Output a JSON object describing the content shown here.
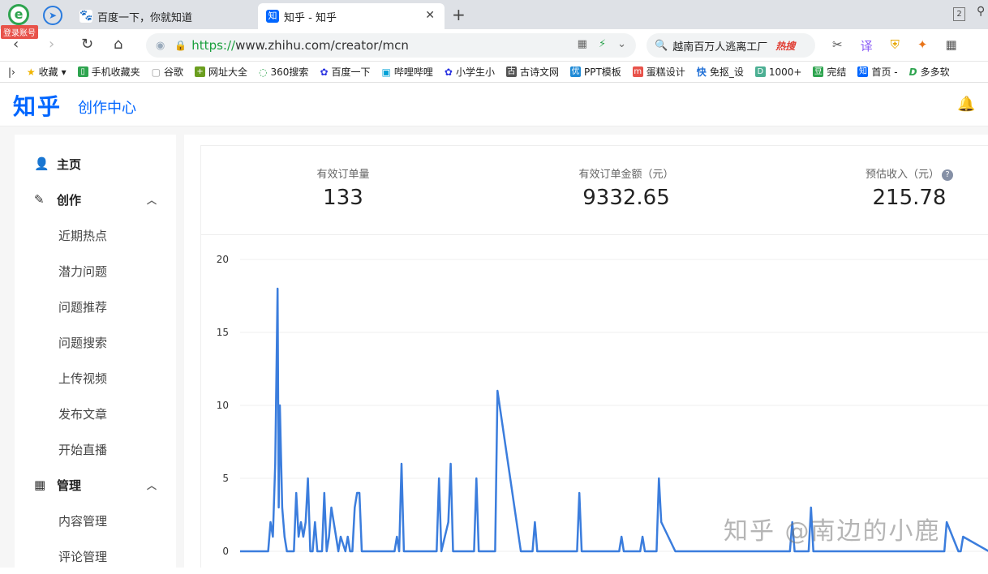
{
  "browser": {
    "login_badge": "登录账号",
    "tabs": [
      {
        "title": "百度一下，你就知道",
        "active": false
      },
      {
        "title": "知乎 - 知乎",
        "active": true
      }
    ],
    "window_count": "2",
    "url_scheme": "https://",
    "url_rest": "www.zhihu.com/creator/mcn",
    "search_query": "越南百万人逃离工厂",
    "search_hot": "热搜",
    "bookmarks": [
      "收藏",
      "手机收藏夹",
      "谷歌",
      "网址大全",
      "360搜索",
      "百度一下",
      "哔哩哔哩",
      "小学生小",
      "古诗文网",
      "PPT模板",
      "蛋糕设计",
      "免抠_设",
      "1000+",
      "完结",
      "首页 -",
      "多多软"
    ]
  },
  "header": {
    "logo": "知乎",
    "subtitle": "创作中心"
  },
  "sidebar": {
    "items": [
      {
        "label": "主页",
        "level": "top",
        "icon": "user-icon"
      },
      {
        "label": "创作",
        "level": "top",
        "icon": "pencil-icon",
        "expanded": true
      },
      {
        "label": "近期热点",
        "level": "sub"
      },
      {
        "label": "潜力问题",
        "level": "sub"
      },
      {
        "label": "问题推荐",
        "level": "sub"
      },
      {
        "label": "问题搜索",
        "level": "sub"
      },
      {
        "label": "上传视频",
        "level": "sub"
      },
      {
        "label": "发布文章",
        "level": "sub"
      },
      {
        "label": "开始直播",
        "level": "sub"
      },
      {
        "label": "管理",
        "level": "top",
        "icon": "grid-icon",
        "expanded": true
      },
      {
        "label": "内容管理",
        "level": "sub"
      },
      {
        "label": "评论管理",
        "level": "sub"
      }
    ]
  },
  "stats": [
    {
      "label": "有效订单量",
      "value": "133"
    },
    {
      "label": "有效订单金额（元）",
      "value": "9332.65"
    },
    {
      "label": "预估收入（元）",
      "value": "215.78"
    }
  ],
  "watermark": "知乎 @南边的小鹿",
  "chart_data": {
    "type": "line",
    "title": "",
    "xlabel": "",
    "ylabel": "",
    "ylim": [
      0,
      20
    ],
    "yticks": [
      0,
      5,
      10,
      15,
      20
    ],
    "grid": true,
    "color": "#3b7ddd",
    "series": [
      {
        "x": [
          0,
          12,
          13,
          14,
          15,
          16,
          16.5,
          17,
          18,
          19,
          20,
          23,
          24,
          25,
          26,
          27,
          28,
          29,
          30,
          31,
          32,
          33,
          34,
          35,
          36,
          37,
          38,
          39,
          41,
          42,
          43,
          45,
          46,
          47,
          48,
          49,
          50,
          51,
          52,
          53,
          54,
          55,
          56,
          57,
          66,
          67,
          68,
          69,
          70,
          84,
          85,
          86,
          89,
          90,
          91,
          92,
          93,
          94,
          95,
          100,
          101,
          102,
          108,
          109,
          110,
          120,
          121,
          122,
          125,
          126,
          127,
          144,
          145,
          146,
          162,
          163,
          164,
          171,
          172,
          173,
          178,
          179,
          180,
          186,
          187,
          188,
          189,
          190,
          235,
          236,
          237,
          243,
          244,
          245,
          246,
          247,
          300,
          301,
          302,
          307,
          308,
          309,
          320
        ],
        "y": [
          0,
          0,
          2,
          1,
          6,
          18,
          3,
          10,
          3,
          1,
          0,
          0,
          4,
          1,
          2,
          1,
          2,
          5,
          0,
          0,
          2,
          0,
          0,
          0,
          4,
          0,
          1,
          3,
          1,
          0,
          1,
          0,
          1,
          0,
          0,
          3,
          4,
          4,
          0,
          0,
          0,
          0,
          0,
          0,
          0,
          1,
          0,
          6,
          0,
          0,
          5,
          0,
          2,
          6,
          0,
          0,
          0,
          0,
          0,
          0,
          5,
          0,
          0,
          0,
          11,
          0,
          0,
          0,
          0,
          2,
          0,
          0,
          4,
          0,
          0,
          1,
          0,
          0,
          1,
          0,
          0,
          5,
          2,
          0,
          0,
          0,
          0,
          0,
          0,
          2,
          0,
          0,
          3,
          0,
          0,
          0,
          0,
          0,
          2,
          0,
          0,
          1,
          0
        ]
      }
    ]
  }
}
